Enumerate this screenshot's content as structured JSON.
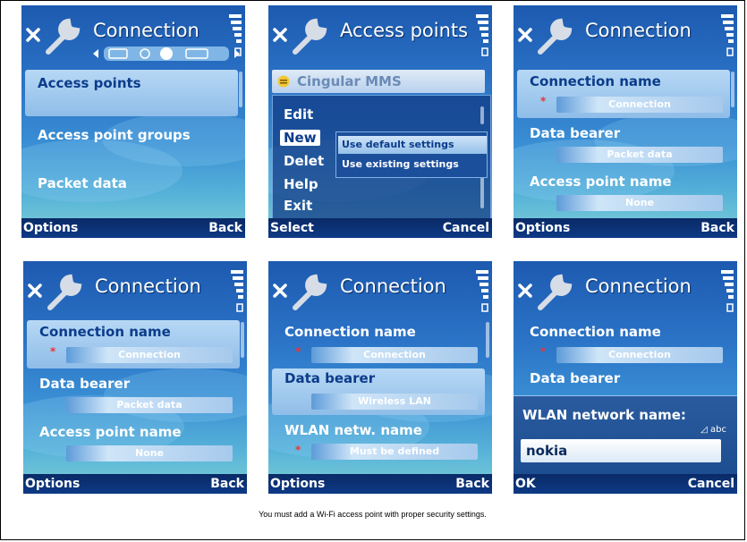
{
  "screens": [
    {
      "title": "Connection",
      "items": [
        "Access points",
        "Access point groups",
        "Packet data"
      ],
      "softkeys": {
        "left": "Options",
        "right": "Back"
      }
    },
    {
      "title": "Access points",
      "list_item": "Cingular MMS",
      "menu": [
        "Edit",
        "New",
        "Delet",
        "Help",
        "Exit"
      ],
      "submenu": [
        "Use default settings",
        "Use existing settings"
      ],
      "softkeys": {
        "left": "Select",
        "right": "Cancel"
      }
    },
    {
      "title": "Connection",
      "fields": [
        {
          "label": "Connection name",
          "value": "Connection"
        },
        {
          "label": "Data bearer",
          "value": "Packet data"
        },
        {
          "label": "Access point name",
          "value": "None"
        }
      ],
      "softkeys": {
        "left": "Options",
        "right": "Back"
      }
    },
    {
      "title": "Connection",
      "fields": [
        {
          "label": "Connection name",
          "value": "Connection"
        },
        {
          "label": "Data bearer",
          "value": "Packet data"
        },
        {
          "label": "Access point name",
          "value": "None"
        }
      ],
      "softkeys": {
        "left": "Options",
        "right": "Back"
      }
    },
    {
      "title": "Connection",
      "fields": [
        {
          "label": "Connection name",
          "value": "Connection"
        },
        {
          "label": "Data bearer",
          "value": "Wireless LAN"
        },
        {
          "label": "WLAN netw. name",
          "value": "Must be defined"
        }
      ],
      "softkeys": {
        "left": "Options",
        "right": "Back"
      }
    },
    {
      "title": "Connection",
      "fields": [
        {
          "label": "Connection name",
          "value": "Connection"
        },
        {
          "label": "Data bearer",
          "value": ""
        }
      ],
      "dialog": {
        "label": "WLAN network name:",
        "mode": "abc",
        "value": "nokia"
      },
      "softkeys": {
        "left": "OK",
        "right": "Cancel"
      }
    }
  ],
  "caption": "You must add a Wi-Fi access point with proper security settings."
}
